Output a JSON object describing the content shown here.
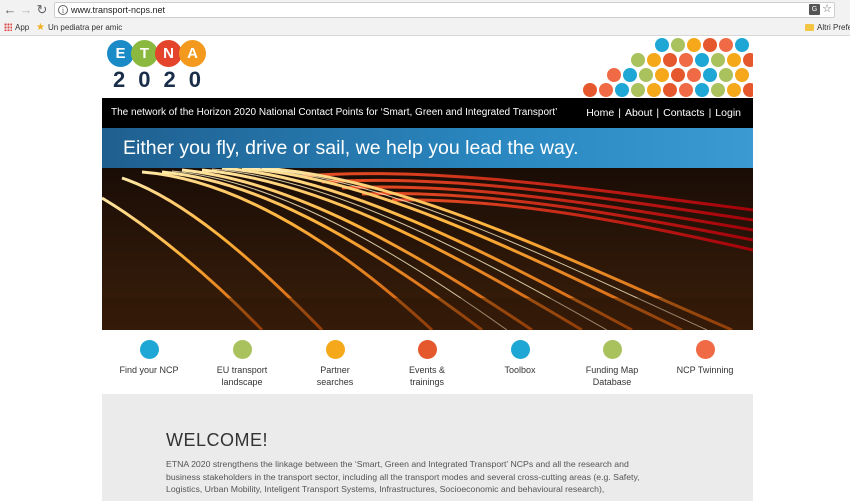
{
  "browser": {
    "url": "www.transport-ncps.net",
    "bookmarks": {
      "apps_label": "App",
      "item1": "Un pediatra per amic",
      "other": "Altri Prefer"
    }
  },
  "logo": {
    "letters": [
      "E",
      "T",
      "N",
      "A"
    ],
    "year": "2020"
  },
  "nav": {
    "tagline": "The network of the Horizon 2020 National Contact Points for ‘Smart, Green and Integrated Transport’",
    "menu": [
      "Home",
      "About",
      "Contacts",
      "Login"
    ],
    "separator": "|"
  },
  "hero": {
    "banner": "Either you fly, drive or sail, we help you lead the way."
  },
  "features": [
    {
      "label": "Find your NCP",
      "color": "#1ea7d4"
    },
    {
      "label": "EU transport landscape",
      "color": "#a9c25d"
    },
    {
      "label": "Partner searches",
      "color": "#f5a91a"
    },
    {
      "label": "Events & trainings",
      "color": "#e5572c"
    },
    {
      "label": "Toolbox",
      "color": "#1ea7d4"
    },
    {
      "label": "Funding Map Database",
      "color": "#a9c25d"
    },
    {
      "label": "NCP Twinning",
      "color": "#ef6a45"
    }
  ],
  "welcome": {
    "title": "WELCOME!",
    "body": "ETNA 2020 strengthens the linkage between the ‘Smart, Green and Integrated Transport’ NCPs and all the research and business stakeholders in the transport sector, including all the transport modes and several cross-cutting areas (e.g. Safety, Logistics, Urban Mobility, Inteligent Transport Systems, Infrastructures, Socioeconomic and behavioural research),"
  },
  "colors": {
    "logo_circles": [
      "#1b8bc7",
      "#8bb93f",
      "#e5442c",
      "#f39a1e"
    ],
    "navbar": "#000000",
    "banner": "#2a87c0",
    "welcome_bg": "#ebebeb"
  }
}
